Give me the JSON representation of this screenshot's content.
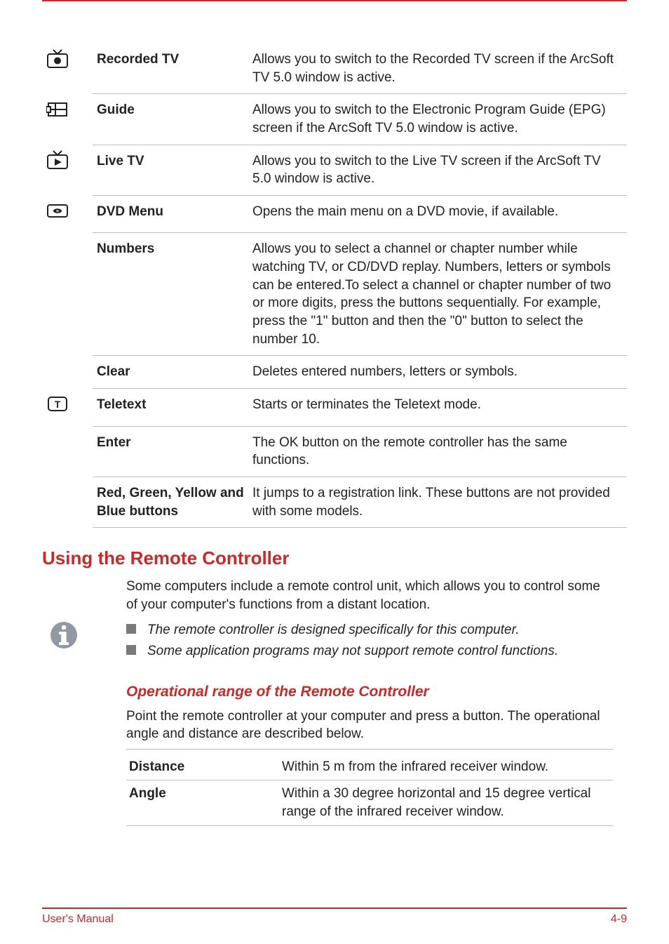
{
  "features": [
    {
      "name": "Recorded TV",
      "desc": "Allows you to switch to the Recorded TV screen if the ArcSoft TV 5.0 window is active.",
      "icon": "recorded-tv-icon"
    },
    {
      "name": "Guide",
      "desc": "Allows you to switch to the Electronic Program Guide (EPG) screen if the ArcSoft TV 5.0 window is active.",
      "icon": "guide-icon"
    },
    {
      "name": "Live TV",
      "desc": "Allows you to switch to the Live TV screen if the ArcSoft TV 5.0 window is active.",
      "icon": "live-tv-icon"
    },
    {
      "name": "DVD Menu",
      "desc": "Opens the main menu on a DVD movie, if available.",
      "icon": "dvd-menu-icon"
    },
    {
      "name": "Numbers",
      "desc": "Allows you to select a channel or chapter number while watching TV, or CD/DVD replay. Numbers, letters or symbols can be entered.To select a channel or chapter number of two or more digits, press the buttons sequentially. For example, press the \"1\" button and then the \"0\" button to select the number 10.",
      "icon": ""
    },
    {
      "name": "Clear",
      "desc": "Deletes entered numbers, letters or symbols.",
      "icon": ""
    },
    {
      "name": "Teletext",
      "desc": "Starts or terminates the Teletext mode.",
      "icon": "teletext-icon"
    },
    {
      "name": "Enter",
      "desc": "The OK button on the remote controller has the same functions.",
      "icon": ""
    },
    {
      "name": "Red, Green, Yellow and Blue buttons",
      "desc": "It jumps to a registration link. These buttons are not provided with some models.",
      "icon": ""
    }
  ],
  "section": {
    "heading": "Using the Remote Controller",
    "intro": "Some computers include a remote control unit, which allows you to control some of your computer's functions from a distant location."
  },
  "notes": [
    "The remote controller is designed specifically for this computer.",
    "Some application programs may not support remote control functions."
  ],
  "operational": {
    "heading": "Operational range of the Remote Controller",
    "intro": "Point the remote controller at your computer and press a button. The operational angle and distance are described below.",
    "rows": [
      {
        "k": "Distance",
        "v": "Within 5 m from the infrared receiver window."
      },
      {
        "k": "Angle",
        "v": "Within a 30 degree horizontal and 15 degree vertical range of the infrared receiver window."
      }
    ]
  },
  "footer": {
    "left": "User's Manual",
    "right": "4-9"
  }
}
